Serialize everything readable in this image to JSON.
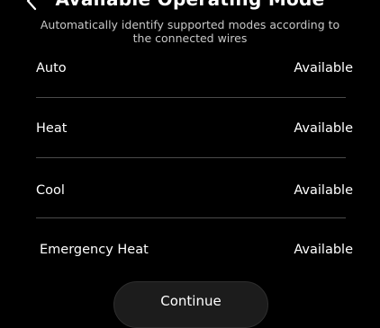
{
  "header": {
    "title": "Available Operating Mode",
    "subtitle": "Automatically identify supported modes according to the connected wires",
    "back_icon": "chevron-left-icon"
  },
  "modes": [
    {
      "label": "Auto",
      "status": "Available"
    },
    {
      "label": "Heat",
      "status": "Available"
    },
    {
      "label": "Cool",
      "status": "Available"
    },
    {
      "label": "Emergency Heat",
      "status": "Available"
    }
  ],
  "footer": {
    "continue_label": "Continue"
  },
  "colors": {
    "background": "#000000",
    "text": "#ffffff",
    "subtitle": "#c8c8c8",
    "divider": "#4a4a4a",
    "button": "#1c1c1c"
  }
}
